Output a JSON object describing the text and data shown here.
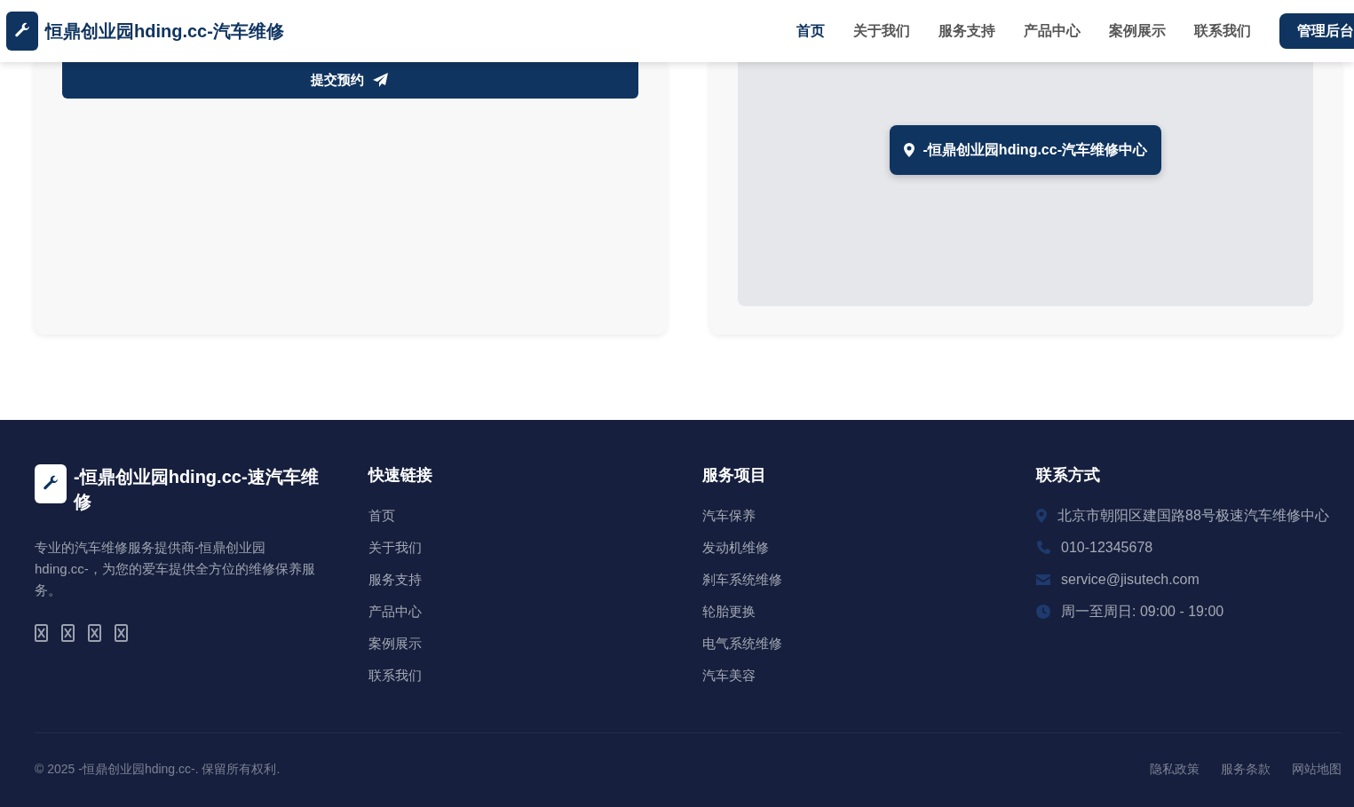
{
  "header": {
    "brand": "恒鼎创业园hding.cc-汽车维修",
    "nav": [
      {
        "label": "首页",
        "selected": true
      },
      {
        "label": "关于我们",
        "selected": false
      },
      {
        "label": "服务支持",
        "selected": false
      },
      {
        "label": "产品中心",
        "selected": false
      },
      {
        "label": "案例展示",
        "selected": false
      },
      {
        "label": "联系我们",
        "selected": false
      }
    ],
    "admin_button": "管理后台"
  },
  "booking_form": {
    "submit_button": "提交预约"
  },
  "map": {
    "marker_label": "-恒鼎创业园hding.cc-汽车维修中心"
  },
  "footer": {
    "brand": "-恒鼎创业园hding.cc-速汽车维修",
    "description": "专业的汽车维修服务提供商-恒鼎创业园hding.cc-，为您的爱车提供全方位的维修保养服务。",
    "social_links": [
      {
        "kind": "missing-glyph"
      },
      {
        "kind": "missing-glyph"
      },
      {
        "kind": "missing-glyph"
      },
      {
        "kind": "missing-glyph"
      }
    ],
    "quick_links": {
      "title": "快速链接",
      "items": [
        "首页",
        "关于我们",
        "服务支持",
        "产品中心",
        "案例展示",
        "联系我们"
      ]
    },
    "services": {
      "title": "服务项目",
      "items": [
        "汽车保养",
        "发动机维修",
        "刹车系统维修",
        "轮胎更换",
        "电气系统维修",
        "汽车美容"
      ]
    },
    "contact": {
      "title": "联系方式",
      "items": [
        {
          "kind": "address",
          "text": "北京市朝阳区建国路88号极速汽车维修中心"
        },
        {
          "kind": "phone",
          "text": "010-12345678"
        },
        {
          "kind": "email",
          "text": "service@jisutech.com"
        },
        {
          "kind": "hours",
          "text": "周一至周日: 09:00 - 19:00"
        }
      ]
    },
    "copyright": "© 2025 -恒鼎创业园hding.cc-. 保留所有权利.",
    "legal_links": [
      "隐私政策",
      "服务条款",
      "网站地图"
    ]
  }
}
